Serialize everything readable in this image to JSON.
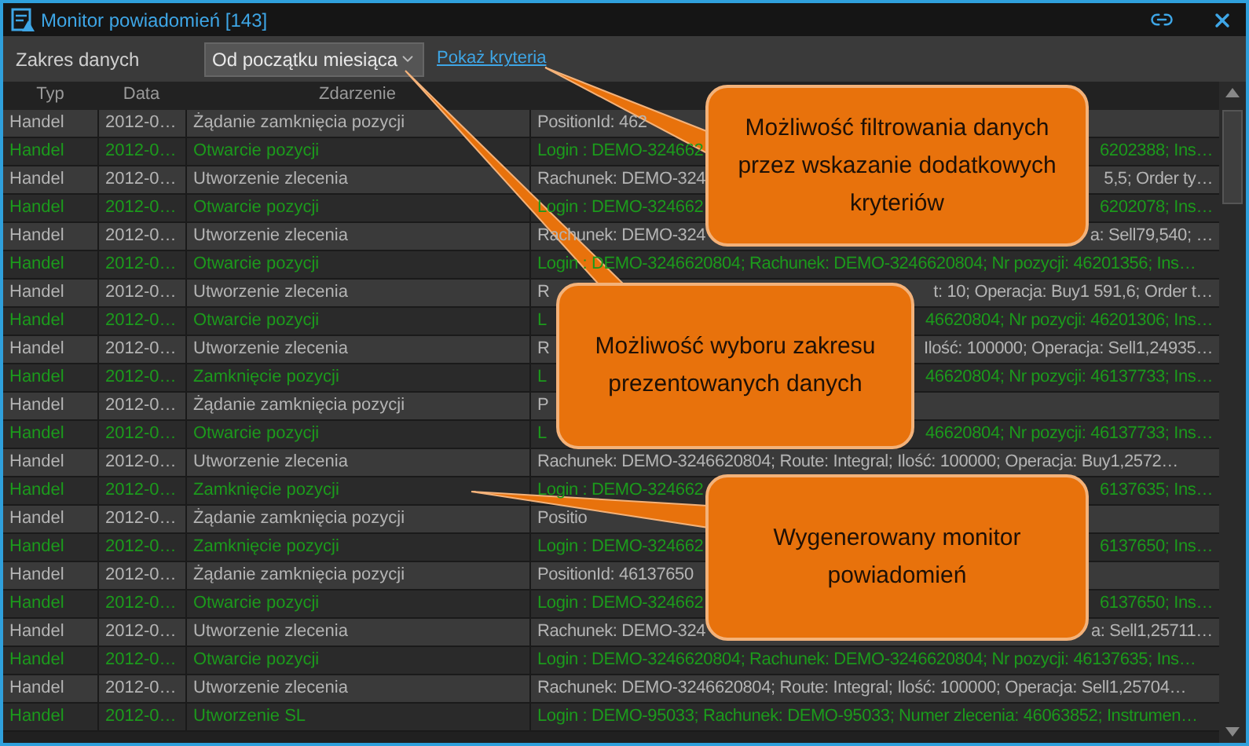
{
  "window": {
    "title": "Monitor powiadomień [143]"
  },
  "filter": {
    "label": "Zakres danych",
    "range": "Od początku miesiąca",
    "criteria_link": "Pokaż kryteria"
  },
  "table": {
    "columns": [
      "Typ",
      "Data",
      "Zdarzenie"
    ],
    "rows": [
      {
        "type": "Handel",
        "date": "2012-0…",
        "event": "Żądanie zamknięcia pozycji",
        "details": [
          "PositionId: 462"
        ],
        "kind": "normal"
      },
      {
        "type": "Handel",
        "date": "2012-0…",
        "event": "Otwarcie pozycji",
        "details": [
          "Login : DEMO-324662",
          "6202388; Ins…"
        ],
        "kind": "highlighted"
      },
      {
        "type": "Handel",
        "date": "2012-0…",
        "event": "Utworzenie zlecenia",
        "details": [
          "Rachunek: DEMO-324",
          "5,5; Order ty…"
        ],
        "kind": "normal"
      },
      {
        "type": "Handel",
        "date": "2012-0…",
        "event": "Otwarcie pozycji",
        "details": [
          "Login : DEMO-324662",
          "6202078; Ins…"
        ],
        "kind": "highlighted"
      },
      {
        "type": "Handel",
        "date": "2012-0…",
        "event": "Utworzenie zlecenia",
        "details": [
          "Rachunek: DEMO-324",
          "a: Sell79,540; …"
        ],
        "kind": "normal"
      },
      {
        "type": "Handel",
        "date": "2012-0…",
        "event": "Otwarcie pozycji",
        "details": [
          "Login : DEMO-3246620804; Rachunek: DEMO-3246620804; Nr pozycji: 46201356; Ins…"
        ],
        "kind": "highlighted"
      },
      {
        "type": "Handel",
        "date": "2012-0…",
        "event": "Utworzenie zlecenia",
        "details": [
          "R",
          "t: 10; Operacja: Buy1 591,6; Order t…"
        ],
        "kind": "normal"
      },
      {
        "type": "Handel",
        "date": "2012-0…",
        "event": "Otwarcie pozycji",
        "details": [
          "L",
          "46620804; Nr pozycji: 46201306; Ins…"
        ],
        "kind": "highlighted"
      },
      {
        "type": "Handel",
        "date": "2012-0…",
        "event": "Utworzenie zlecenia",
        "details": [
          "R",
          "Ilość: 100000; Operacja: Sell1,24935…"
        ],
        "kind": "normal"
      },
      {
        "type": "Handel",
        "date": "2012-0…",
        "event": "Zamknięcie pozycji",
        "details": [
          "L",
          "46620804; Nr pozycji: 46137733; Ins…"
        ],
        "kind": "highlighted"
      },
      {
        "type": "Handel",
        "date": "2012-0…",
        "event": "Żądanie zamknięcia pozycji",
        "details": [
          "P"
        ],
        "kind": "normal"
      },
      {
        "type": "Handel",
        "date": "2012-0…",
        "event": "Otwarcie pozycji",
        "details": [
          "L",
          "46620804; Nr pozycji: 46137733; Ins…"
        ],
        "kind": "highlighted"
      },
      {
        "type": "Handel",
        "date": "2012-0…",
        "event": "Utworzenie zlecenia",
        "details": [
          "Rachunek: DEMO-3246620804; Route: Integral; Ilość: 100000; Operacja: Buy1,2572…"
        ],
        "kind": "normal"
      },
      {
        "type": "Handel",
        "date": "2012-0…",
        "event": "Zamknięcie pozycji",
        "details": [
          "Login : DEMO-324662",
          "6137635; Ins…"
        ],
        "kind": "highlighted"
      },
      {
        "type": "Handel",
        "date": "2012-0…",
        "event": "Żądanie zamknięcia pozycji",
        "details": [
          "Positio"
        ],
        "kind": "normal"
      },
      {
        "type": "Handel",
        "date": "2012-0…",
        "event": "Zamknięcie pozycji",
        "details": [
          "Login : DEMO-324662",
          "6137650; Ins…"
        ],
        "kind": "highlighted"
      },
      {
        "type": "Handel",
        "date": "2012-0…",
        "event": "Żądanie zamknięcia pozycji",
        "details": [
          "PositionId: 46137650"
        ],
        "kind": "normal"
      },
      {
        "type": "Handel",
        "date": "2012-0…",
        "event": "Otwarcie pozycji",
        "details": [
          "Login : DEMO-324662",
          "6137650; Ins…"
        ],
        "kind": "highlighted"
      },
      {
        "type": "Handel",
        "date": "2012-0…",
        "event": "Utworzenie zlecenia",
        "details": [
          "Rachunek: DEMO-324",
          "a: Sell1,25711…"
        ],
        "kind": "normal"
      },
      {
        "type": "Handel",
        "date": "2012-0…",
        "event": "Otwarcie pozycji",
        "details": [
          "Login : DEMO-3246620804; Rachunek: DEMO-3246620804; Nr pozycji: 46137635; Ins…"
        ],
        "kind": "highlighted"
      },
      {
        "type": "Handel",
        "date": "2012-0…",
        "event": "Utworzenie zlecenia",
        "details": [
          "Rachunek: DEMO-3246620804; Route: Integral; Ilość: 100000; Operacja: Sell1,25704…"
        ],
        "kind": "normal"
      },
      {
        "type": "Handel",
        "date": "2012-0…",
        "event": "Utworzenie SL",
        "details": [
          "Login : DEMO-95033; Rachunek: DEMO-95033; Numer zlecenia: 46063852; Instrumen…"
        ],
        "kind": "highlighted"
      }
    ]
  },
  "callouts": [
    {
      "text": "Możliwość filtrowania danych przez wskazanie dodatkowych kryteriów"
    },
    {
      "text": "Możliwość wyboru zakresu prezentowanych danych"
    },
    {
      "text": "Wygenerowany monitor powiadomień"
    }
  ]
}
